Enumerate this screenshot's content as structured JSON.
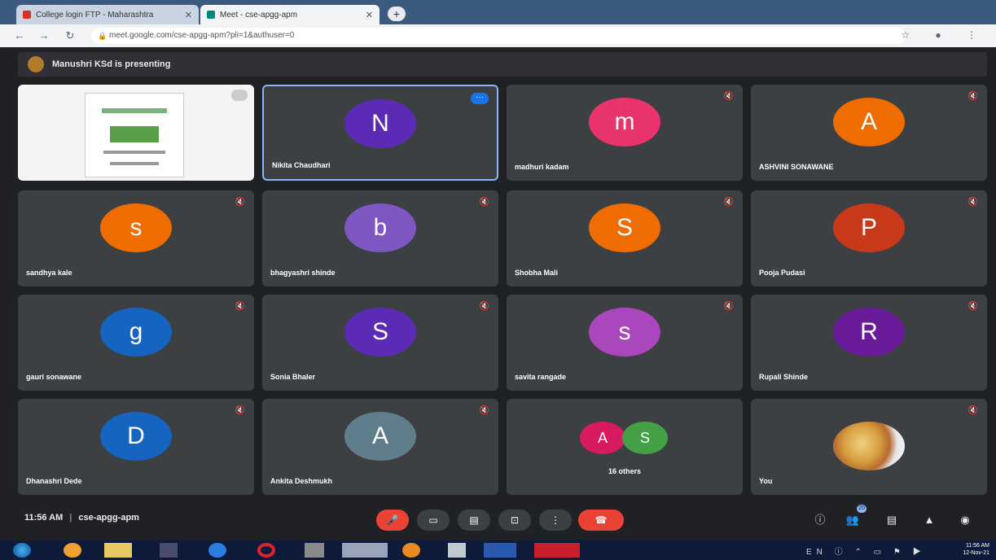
{
  "browser": {
    "tabs": [
      {
        "label": "College login FTP - Maharashtra"
      },
      {
        "label": "Meet - cse-apgg-apm"
      }
    ],
    "new_tab": "+",
    "url": "meet.google.com/cse-apgg-apm?pli=1&authuser=0",
    "nav": {
      "back": "←",
      "forward": "→",
      "reload": "↻"
    },
    "ext_icons": "☆ ● ⋮"
  },
  "presenting_banner": {
    "text": "Manushri KSd is presenting"
  },
  "tiles": [
    {
      "name": "Nikita Chaudhari",
      "initial": "N",
      "color": "#5b2bb5",
      "more": "···"
    },
    {
      "name": "madhuri kadam",
      "initial": "m",
      "color": "#e8336d"
    },
    {
      "name": "ASHVINI SONAWANE",
      "initial": "A",
      "color": "#ef6c00"
    },
    {
      "name": "sandhya kale",
      "initial": "s",
      "color": "#ef6c00"
    },
    {
      "name": "bhagyashri shinde",
      "initial": "b",
      "color": "#7e57c2"
    },
    {
      "name": "Shobha Mali",
      "initial": "S",
      "color": "#ef6c00"
    },
    {
      "name": "Pooja Pudasi",
      "initial": "P",
      "color": "#c8391a"
    },
    {
      "name": "gauri sonawane",
      "initial": "g",
      "color": "#1565c0"
    },
    {
      "name": "Sonia Bhaler",
      "initial": "S",
      "color": "#5b2bb5"
    },
    {
      "name": "savita rangade",
      "initial": "s",
      "color": "#ab47bc"
    },
    {
      "name": "Rupali Shinde",
      "initial": "R",
      "color": "#6a1b9a"
    },
    {
      "name": "Dhanashri Dede",
      "initial": "D",
      "color": "#1565c0"
    },
    {
      "name": "Ankita Deshmukh",
      "initial": "A",
      "color": "#607d8b"
    }
  ],
  "others": {
    "a1": "A",
    "a2": "S",
    "count": "16 others"
  },
  "you": {
    "name": "You"
  },
  "mic_icon": "🔇",
  "bottom": {
    "time": "11:56 AM",
    "separator": "|",
    "meeting_code": "cse-apgg-apm",
    "controls": {
      "mic": "🎤",
      "camera": "▭",
      "captions": "▤",
      "present": "⊡",
      "more": "⋮",
      "end": "☎"
    },
    "right": {
      "info": "ⓘ",
      "people": "👥",
      "people_badge": "20",
      "chat": "▤",
      "activities": "▲",
      "lock": "◉"
    }
  },
  "taskbar": {
    "time": "11:56 AM",
    "date": "12-Nov-21",
    "tray": "EN ⓘ ⌃  ▭ ⚑ ▶"
  }
}
